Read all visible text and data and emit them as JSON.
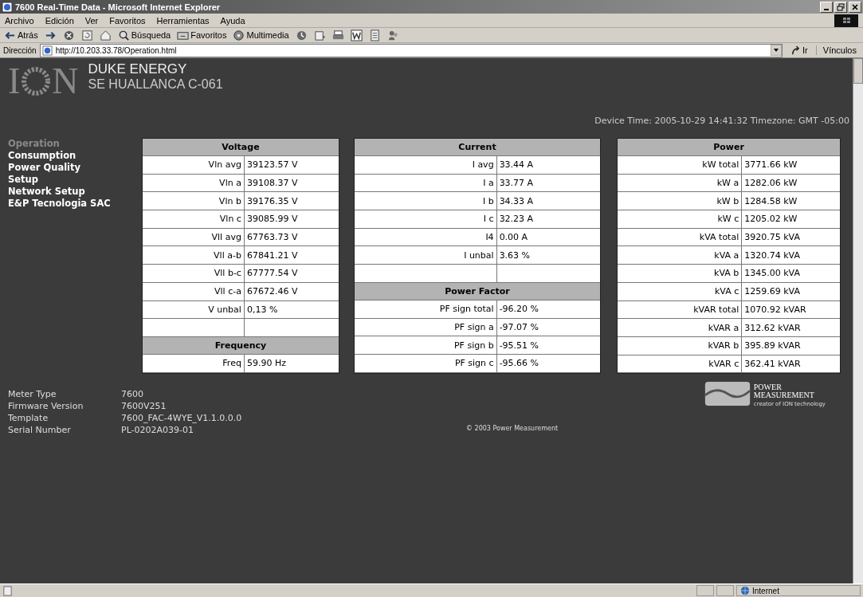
{
  "window": {
    "title": "7600 Real-Time Data - Microsoft Internet Explorer"
  },
  "menu": [
    "Archivo",
    "Edición",
    "Ver",
    "Favoritos",
    "Herramientas",
    "Ayuda"
  ],
  "toolbar": [
    {
      "kind": "back",
      "label": "Atrás"
    },
    {
      "kind": "forward"
    },
    {
      "kind": "stop"
    },
    {
      "kind": "refresh"
    },
    {
      "kind": "home"
    },
    {
      "kind": "search",
      "label": "Búsqueda"
    },
    {
      "kind": "favorites",
      "label": "Favoritos"
    },
    {
      "kind": "media",
      "label": "Multimedia"
    },
    {
      "kind": "history"
    },
    {
      "kind": "mail"
    },
    {
      "kind": "print"
    },
    {
      "kind": "word"
    },
    {
      "kind": "edit"
    },
    {
      "kind": "messenger"
    }
  ],
  "address": {
    "label": "Dirección",
    "url": "http://10.203.33.78/Operation.html",
    "go": "Ir",
    "links": "Vínculos"
  },
  "page": {
    "logo": {
      "left": "I",
      "right": "N"
    },
    "company": "DUKE ENERGY",
    "site": "SE HUALLANCA C-061",
    "device_time": "Device Time: 2005-10-29 14:41:32 Timezone: GMT -05:00",
    "nav": [
      {
        "label": "Operation",
        "selected": true
      },
      {
        "label": "Consumption",
        "selected": false
      },
      {
        "label": "Power Quality",
        "selected": false
      },
      {
        "label": "Setup",
        "selected": false
      },
      {
        "label": "Network Setup",
        "selected": false
      },
      {
        "label": "E&P Tecnologia SAC",
        "selected": false
      }
    ],
    "panels": [
      {
        "sections": [
          {
            "title": "Voltage",
            "rows": [
              {
                "label": "Vln avg",
                "value": "39123.57 V"
              },
              {
                "label": "Vln a",
                "value": "39108.37 V"
              },
              {
                "label": "Vln b",
                "value": "39176.35 V"
              },
              {
                "label": "Vln c",
                "value": "39085.99 V"
              },
              {
                "label": "Vll avg",
                "value": "67763.73 V"
              },
              {
                "label": "Vll a-b",
                "value": "67841.21 V"
              },
              {
                "label": "Vll b-c",
                "value": "67777.54 V"
              },
              {
                "label": "Vll c-a",
                "value": "67672.46 V"
              },
              {
                "label": "V unbal",
                "value": "0,13 %"
              }
            ],
            "blank_row": true
          },
          {
            "title": "Frequency",
            "rows": [
              {
                "label": "Freq",
                "value": "59.90 Hz"
              }
            ]
          }
        ]
      },
      {
        "sections": [
          {
            "title": "Current",
            "rows": [
              {
                "label": "I avg",
                "value": "33.44 A"
              },
              {
                "label": "I a",
                "value": "33.77 A"
              },
              {
                "label": "I b",
                "value": "34.33 A"
              },
              {
                "label": "I c",
                "value": "32.23 A"
              },
              {
                "label": "I4",
                "value": "0.00 A"
              },
              {
                "label": "I unbal",
                "value": "3.63 %"
              }
            ],
            "blank_row": true
          },
          {
            "title": "Power Factor",
            "rows": [
              {
                "label": "PF sign total",
                "value": "-96.20 %"
              },
              {
                "label": "PF sign a",
                "value": "-97.07 %"
              },
              {
                "label": "PF sign b",
                "value": "-95.51 %"
              },
              {
                "label": "PF sign c",
                "value": "-95.66 %"
              }
            ]
          }
        ]
      },
      {
        "sections": [
          {
            "title": "Power",
            "rows": [
              {
                "label": "kW total",
                "value": "3771.66 kW"
              },
              {
                "label": "kW a",
                "value": "1282.06 kW"
              },
              {
                "label": "kW b",
                "value": "1284.58 kW"
              },
              {
                "label": "kW c",
                "value": "1205.02 kW"
              },
              {
                "label": "kVA total",
                "value": "3920.75 kVA"
              },
              {
                "label": "kVA a",
                "value": "1320.74 kVA"
              },
              {
                "label": "kVA b",
                "value": "1345.00 kVA"
              },
              {
                "label": "kVA c",
                "value": "1259.69 kVA"
              },
              {
                "label": "kVAR total",
                "value": "1070.92 kVAR"
              },
              {
                "label": "kVAR a",
                "value": "312.62 kVAR"
              },
              {
                "label": "kVAR b",
                "value": "395.89 kVAR"
              },
              {
                "label": "kVAR c",
                "value": "362.41 kVAR"
              }
            ]
          }
        ]
      }
    ],
    "meter_info": [
      {
        "label": "Meter Type",
        "value": "7600"
      },
      {
        "label": "Firmware Version",
        "value": "7600V251"
      },
      {
        "label": "Template",
        "value": "7600_FAC-4WYE_V1.1.0.0.0"
      },
      {
        "label": "Serial Number",
        "value": "PL-0202A039-01"
      }
    ],
    "copyright": "© 2003 Power Measurement",
    "brand": {
      "line1": "POWER",
      "line2": "MEASUREMENT",
      "tagline": "creator of ION technology"
    }
  },
  "status_bar": {
    "zone": "Internet"
  }
}
